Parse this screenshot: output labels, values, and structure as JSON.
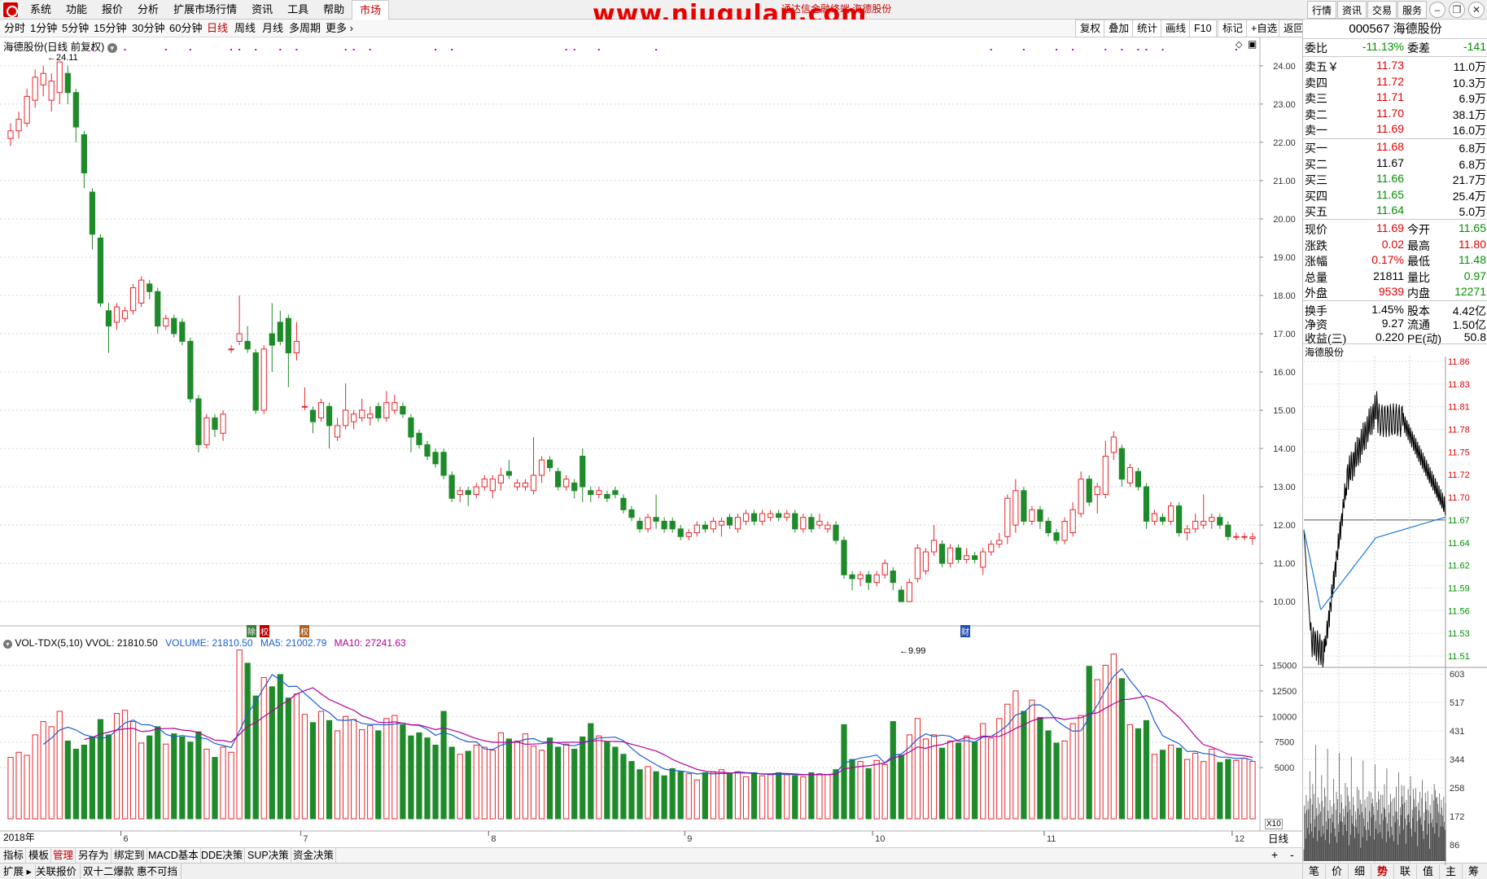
{
  "menu": {
    "items": [
      "系统",
      "功能",
      "报价",
      "分析",
      "扩展市场行情",
      "资讯",
      "工具",
      "帮助",
      "市场"
    ],
    "watermark": "www.niugulan.com",
    "center_title": "通达信金融终端 海德股份",
    "right_buttons": [
      "行情",
      "资讯",
      "交易",
      "服务"
    ]
  },
  "periods": [
    "分时",
    "1分钟",
    "5分钟",
    "15分钟",
    "30分钟",
    "60分钟",
    "日线",
    "周线",
    "月线",
    "多周期",
    "更多"
  ],
  "selected_period": "日线",
  "right_tools": [
    "复权",
    "叠加",
    "统计",
    "画线",
    "F10",
    "标记",
    "+自选",
    "返回"
  ],
  "chart_title": "海德股份(日线 前复权)",
  "price_max_label": "24.11",
  "price_min_label": "9.99",
  "event_labels": [
    "除",
    "权",
    "财"
  ],
  "vol_header": {
    "name": "VOL-TDX(5,10)",
    "vvol": "VVOL: 21810.50",
    "volume": "VOLUME: 21810.50",
    "ma5": "MA5: 21002.79",
    "ma10": "MA10: 27241.63"
  },
  "x_year_label": "2018年",
  "x_period_label": "日线",
  "x10_label": "X10",
  "bottom_tabs": [
    "指标",
    "模板",
    "管理",
    "另存为",
    "绑定到",
    "MACD基本",
    "DDE决策",
    "SUP决策",
    "资金决策"
  ],
  "status_bar": [
    "扩展",
    "关联报价",
    "双十二爆款 惠不可挡"
  ],
  "quote": {
    "header": "000567 海德股份",
    "weibi": {
      "label": "委比",
      "value": "-11.13%",
      "label2": "委差",
      "value2": "-141"
    },
    "asks": [
      {
        "label": "卖五￥",
        "price": "11.73",
        "vol": "11.0万"
      },
      {
        "label": "卖四",
        "price": "11.72",
        "vol": "10.3万"
      },
      {
        "label": "卖三",
        "price": "11.71",
        "vol": "6.9万"
      },
      {
        "label": "卖二",
        "price": "11.70",
        "vol": "38.1万"
      },
      {
        "label": "卖一",
        "price": "11.69",
        "vol": "16.0万"
      }
    ],
    "bids": [
      {
        "label": "买一",
        "price": "11.68",
        "vol": "6.8万"
      },
      {
        "label": "买二",
        "price": "11.67",
        "vol": "6.8万"
      },
      {
        "label": "买三",
        "price": "11.66",
        "vol": "21.7万"
      },
      {
        "label": "买四",
        "price": "11.65",
        "vol": "25.4万"
      },
      {
        "label": "买五",
        "price": "11.64",
        "vol": "5.0万"
      }
    ],
    "stats": [
      {
        "l1": "现价",
        "v1": "11.69",
        "c1": "red",
        "l2": "今开",
        "v2": "11.65",
        "c2": "green"
      },
      {
        "l1": "涨跌",
        "v1": "0.02",
        "c1": "red",
        "l2": "最高",
        "v2": "11.80",
        "c2": "red"
      },
      {
        "l1": "涨幅",
        "v1": "0.17%",
        "c1": "red",
        "l2": "最低",
        "v2": "11.48",
        "c2": "green"
      },
      {
        "l1": "总量",
        "v1": "21811",
        "c1": "black",
        "l2": "量比",
        "v2": "0.97",
        "c2": "green"
      },
      {
        "l1": "外盘",
        "v1": "9539",
        "c1": "red",
        "l2": "内盘",
        "v2": "12271",
        "c2": "green"
      }
    ],
    "stats2": [
      {
        "l1": "换手",
        "v1": "1.45%",
        "l2": "股本",
        "v2": "4.42亿"
      },
      {
        "l1": "净资",
        "v1": "9.27",
        "l2": "流通",
        "v2": "1.50亿"
      },
      {
        "l1": "收益(三)",
        "v1": "0.220",
        "l2": "PE(动)",
        "v2": "50.8"
      }
    ]
  },
  "mini_chart": {
    "title": "海德股份",
    "price_labels": [
      "11.86",
      "11.83",
      "11.81",
      "11.78",
      "11.75",
      "11.72",
      "11.70",
      "11.67",
      "11.64",
      "11.62",
      "11.59",
      "11.56",
      "11.53",
      "11.51"
    ],
    "vol_labels": [
      "603",
      "517",
      "431",
      "344",
      "258",
      "172",
      "86"
    ]
  },
  "mini_tabs": [
    "笔",
    "价",
    "细",
    "势",
    "联",
    "值",
    "主",
    "筹"
  ],
  "mini_tab_selected": "势",
  "chart_data": {
    "type": "candlestick",
    "y_ticks": [
      "24.00",
      "23.00",
      "22.00",
      "21.00",
      "20.00",
      "19.00",
      "18.00",
      "17.00",
      "16.00",
      "15.00",
      "14.00",
      "13.00",
      "12.00",
      "11.00",
      "10.00"
    ],
    "ylim": [
      9.6,
      24.4
    ],
    "x_month_labels": [
      "6",
      "7",
      "8",
      "9",
      "10",
      "11",
      "12"
    ],
    "vol_ticks": [
      "15000",
      "12500",
      "10000",
      "7500",
      "5000"
    ],
    "vol_ylim": [
      0,
      17500
    ],
    "candles": [
      [
        22.1,
        22.3,
        21.9,
        22.5
      ],
      [
        22.3,
        22.6,
        22.1,
        22.8
      ],
      [
        22.5,
        23.2,
        22.4,
        23.4
      ],
      [
        23.1,
        23.7,
        22.9,
        23.9
      ],
      [
        23.5,
        23.8,
        23.2,
        24.0
      ],
      [
        23.1,
        23.6,
        22.8,
        23.8
      ],
      [
        23.3,
        24.1,
        23.0,
        24.11
      ],
      [
        23.8,
        23.3,
        23.0,
        24.0
      ],
      [
        23.3,
        22.4,
        22.0,
        23.4
      ],
      [
        22.2,
        21.2,
        20.8,
        22.3
      ],
      [
        20.7,
        19.6,
        19.2,
        20.8
      ],
      [
        19.5,
        17.8,
        17.7,
        19.6
      ],
      [
        17.6,
        17.2,
        16.5,
        17.8
      ],
      [
        17.3,
        17.7,
        17.1,
        17.8
      ],
      [
        17.4,
        17.6,
        17.3,
        17.7
      ],
      [
        17.6,
        18.2,
        17.5,
        18.3
      ],
      [
        17.8,
        18.4,
        17.7,
        18.5
      ],
      [
        18.3,
        18.1,
        17.9,
        18.4
      ],
      [
        18.1,
        17.2,
        17.0,
        18.2
      ],
      [
        17.2,
        17.4,
        17.1,
        17.5
      ],
      [
        17.4,
        17.0,
        16.9,
        17.5
      ],
      [
        17.3,
        16.8,
        16.7,
        17.4
      ],
      [
        16.8,
        15.3,
        15.2,
        16.9
      ],
      [
        15.3,
        14.1,
        13.9,
        15.4
      ],
      [
        14.1,
        14.8,
        14.0,
        14.9
      ],
      [
        14.8,
        14.5,
        14.3,
        14.9
      ],
      [
        14.4,
        14.9,
        14.2,
        15.0
      ],
      [
        16.6,
        16.6,
        16.5,
        16.7
      ],
      [
        16.8,
        17.0,
        16.7,
        18.0
      ],
      [
        16.8,
        16.6,
        16.5,
        17.2
      ],
      [
        16.5,
        15.0,
        14.9,
        16.6
      ],
      [
        15.0,
        16.6,
        14.9,
        16.7
      ],
      [
        17.0,
        16.7,
        16.0,
        17.8
      ],
      [
        17.3,
        16.8,
        16.7,
        17.6
      ],
      [
        17.4,
        16.5,
        15.6,
        17.5
      ],
      [
        16.5,
        16.8,
        16.3,
        17.3
      ],
      [
        15.1,
        15.1,
        15.0,
        15.6
      ],
      [
        15.0,
        14.7,
        14.4,
        15.1
      ],
      [
        14.8,
        15.2,
        14.7,
        15.3
      ],
      [
        15.1,
        14.6,
        14.0,
        15.2
      ],
      [
        14.3,
        14.6,
        14.2,
        14.8
      ],
      [
        14.6,
        15.0,
        14.5,
        15.7
      ],
      [
        14.7,
        14.9,
        14.5,
        15.0
      ],
      [
        14.8,
        15.0,
        14.7,
        15.3
      ],
      [
        14.8,
        14.9,
        14.6,
        15.1
      ],
      [
        15.1,
        14.8,
        14.7,
        15.2
      ],
      [
        14.8,
        15.2,
        14.7,
        15.5
      ],
      [
        15.0,
        15.2,
        14.9,
        15.4
      ],
      [
        15.1,
        14.9,
        14.8,
        15.2
      ],
      [
        14.8,
        14.3,
        13.9,
        14.9
      ],
      [
        14.4,
        14.1,
        14.0,
        14.5
      ],
      [
        14.1,
        13.8,
        13.7,
        14.2
      ],
      [
        13.9,
        13.6,
        13.5,
        14.0
      ],
      [
        13.9,
        13.3,
        13.2,
        14.0
      ],
      [
        13.3,
        12.7,
        12.6,
        13.4
      ],
      [
        12.8,
        12.9,
        12.6,
        13.0
      ],
      [
        12.9,
        12.8,
        12.5,
        13.0
      ],
      [
        12.8,
        13.0,
        12.7,
        13.1
      ],
      [
        13.0,
        13.2,
        12.9,
        13.3
      ],
      [
        12.9,
        13.2,
        12.7,
        13.3
      ],
      [
        13.1,
        13.3,
        12.9,
        13.5
      ],
      [
        13.4,
        13.3,
        13.2,
        13.7
      ],
      [
        13.0,
        13.1,
        12.9,
        13.2
      ],
      [
        13.0,
        13.1,
        12.9,
        13.2
      ],
      [
        12.9,
        13.3,
        12.8,
        14.3
      ],
      [
        13.3,
        13.7,
        13.1,
        13.8
      ],
      [
        13.7,
        13.5,
        13.4,
        13.8
      ],
      [
        13.4,
        13.0,
        12.9,
        13.5
      ],
      [
        13.0,
        13.2,
        12.9,
        13.3
      ],
      [
        13.1,
        12.9,
        12.7,
        13.2
      ],
      [
        13.8,
        13.0,
        12.6,
        14.0
      ],
      [
        12.9,
        12.8,
        12.6,
        13.0
      ],
      [
        12.8,
        12.9,
        12.7,
        13.0
      ],
      [
        12.8,
        12.7,
        12.6,
        12.9
      ],
      [
        12.9,
        12.8,
        12.7,
        13.0
      ],
      [
        12.7,
        12.4,
        12.3,
        12.8
      ],
      [
        12.4,
        12.2,
        12.1,
        12.5
      ],
      [
        12.1,
        11.9,
        11.8,
        12.2
      ],
      [
        11.9,
        12.2,
        11.8,
        12.3
      ],
      [
        12.2,
        12.1,
        11.9,
        12.8
      ],
      [
        12.1,
        11.9,
        11.8,
        12.2
      ],
      [
        12.1,
        11.9,
        11.8,
        12.2
      ],
      [
        11.9,
        11.7,
        11.6,
        12.0
      ],
      [
        11.7,
        11.8,
        11.6,
        11.9
      ],
      [
        11.8,
        12.0,
        11.7,
        12.1
      ],
      [
        12.0,
        11.9,
        11.8,
        12.1
      ],
      [
        11.9,
        12.1,
        11.8,
        12.2
      ],
      [
        12.0,
        12.1,
        11.7,
        12.2
      ],
      [
        12.2,
        12.0,
        11.9,
        12.3
      ],
      [
        11.9,
        12.2,
        11.8,
        12.3
      ],
      [
        12.1,
        12.3,
        12.0,
        12.4
      ],
      [
        12.3,
        12.1,
        12.0,
        12.4
      ],
      [
        12.1,
        12.3,
        12.0,
        12.4
      ],
      [
        12.2,
        12.3,
        12.1,
        12.4
      ],
      [
        12.3,
        12.2,
        12.1,
        12.4
      ],
      [
        12.2,
        12.3,
        12.1,
        12.4
      ],
      [
        12.3,
        11.9,
        11.8,
        12.4
      ],
      [
        11.9,
        12.2,
        11.8,
        12.3
      ],
      [
        12.2,
        11.9,
        11.8,
        12.3
      ],
      [
        12.0,
        12.1,
        11.9,
        12.3
      ],
      [
        11.9,
        12.0,
        11.8,
        12.1
      ],
      [
        12.0,
        11.6,
        11.5,
        12.1
      ],
      [
        11.6,
        10.7,
        10.6,
        11.7
      ],
      [
        10.7,
        10.6,
        10.3,
        10.8
      ],
      [
        10.6,
        10.7,
        10.4,
        10.8
      ],
      [
        10.7,
        10.5,
        10.3,
        10.8
      ],
      [
        10.5,
        10.7,
        10.4,
        10.8
      ],
      [
        10.7,
        11.0,
        10.6,
        11.1
      ],
      [
        10.8,
        10.5,
        10.3,
        10.9
      ],
      [
        10.3,
        10.0,
        9.99,
        10.4
      ],
      [
        10.0,
        10.5,
        9.99,
        10.6
      ],
      [
        10.6,
        11.4,
        10.5,
        11.5
      ],
      [
        10.8,
        11.3,
        10.7,
        11.4
      ],
      [
        11.3,
        11.6,
        11.2,
        12.0
      ],
      [
        11.5,
        11.0,
        10.9,
        11.6
      ],
      [
        11.0,
        11.4,
        10.9,
        11.5
      ],
      [
        11.4,
        11.1,
        11.0,
        11.5
      ],
      [
        11.1,
        11.2,
        11.0,
        11.4
      ],
      [
        11.2,
        11.1,
        11.0,
        11.3
      ],
      [
        10.9,
        11.3,
        10.7,
        11.4
      ],
      [
        11.3,
        11.5,
        11.2,
        11.6
      ],
      [
        11.5,
        11.6,
        11.4,
        11.8
      ],
      [
        11.7,
        12.7,
        11.5,
        12.8
      ],
      [
        12.0,
        12.9,
        11.8,
        13.2
      ],
      [
        12.9,
        12.1,
        12.0,
        13.0
      ],
      [
        12.1,
        12.4,
        12.0,
        12.5
      ],
      [
        12.4,
        12.1,
        11.9,
        12.5
      ],
      [
        12.1,
        11.8,
        11.7,
        12.2
      ],
      [
        11.8,
        11.6,
        11.5,
        11.9
      ],
      [
        11.6,
        12.1,
        11.5,
        12.2
      ],
      [
        11.8,
        12.4,
        11.7,
        12.6
      ],
      [
        12.3,
        13.2,
        12.2,
        13.4
      ],
      [
        13.2,
        12.6,
        12.5,
        13.3
      ],
      [
        12.8,
        13.0,
        12.3,
        13.1
      ],
      [
        12.8,
        13.8,
        12.7,
        14.2
      ],
      [
        13.9,
        14.3,
        13.7,
        14.45
      ],
      [
        14.0,
        13.2,
        13.0,
        14.1
      ],
      [
        13.1,
        13.5,
        13.0,
        13.6
      ],
      [
        13.4,
        13.0,
        12.9,
        13.5
      ],
      [
        13.0,
        12.1,
        11.9,
        13.1
      ],
      [
        12.1,
        12.3,
        12.0,
        12.4
      ],
      [
        12.2,
        12.1,
        12.0,
        12.3
      ],
      [
        12.1,
        12.5,
        12.0,
        12.6
      ],
      [
        12.5,
        11.8,
        11.7,
        12.6
      ],
      [
        11.8,
        11.9,
        11.6,
        12.0
      ],
      [
        11.9,
        12.1,
        11.8,
        12.3
      ],
      [
        12.0,
        12.1,
        11.9,
        12.8
      ],
      [
        12.1,
        12.2,
        11.9,
        12.3
      ],
      [
        12.2,
        12.0,
        11.9,
        12.3
      ],
      [
        12.0,
        11.7,
        11.6,
        12.1
      ],
      [
        11.7,
        11.7,
        11.6,
        11.8
      ],
      [
        11.7,
        11.7,
        11.6,
        11.8
      ],
      [
        11.65,
        11.69,
        11.48,
        11.8
      ]
    ],
    "volumes": [
      6000,
      6500,
      6200,
      8200,
      9500,
      9000,
      10500,
      7600,
      6800,
      7200,
      8000,
      9700,
      8200,
      10300,
      10600,
      9500,
      7400,
      8100,
      9000,
      7300,
      8300,
      8000,
      7500,
      8500,
      6800,
      6000,
      7000,
      6500,
      16500,
      15200,
      12000,
      13800,
      12900,
      14100,
      11800,
      12200,
      10200,
      9400,
      10500,
      9600,
      8600,
      10000,
      9700,
      8700,
      9100,
      8600,
      9800,
      10100,
      9200,
      8100,
      8400,
      7900,
      7200,
      10500,
      7000,
      6300,
      6600,
      7200,
      7000,
      6700,
      8400,
      7800,
      7600,
      8300,
      7100,
      6700,
      7900,
      7000,
      7300,
      6800,
      8000,
      9300,
      8100,
      7500,
      7000,
      6300,
      5600,
      4800,
      5100,
      4600,
      4200,
      4900,
      4600,
      4400,
      3800,
      4500,
      4600,
      4800,
      4400,
      4600,
      4100,
      4500,
      4200,
      4300,
      4500,
      4300,
      4200,
      4100,
      4500,
      4400,
      4300,
      4800,
      9200,
      5800,
      5600,
      4900,
      5700,
      5300,
      9500,
      6200,
      8200,
      9800,
      7800,
      8200,
      6900,
      7600,
      7400,
      8100,
      7500,
      9300,
      7900,
      9800,
      11200,
      12500,
      10500,
      11600,
      9900,
      8600,
      7400,
      7600,
      9300,
      10100,
      14900,
      13600,
      15000,
      16100,
      13700,
      9200,
      8800,
      9600,
      6300,
      6700,
      7200,
      6900,
      5800,
      6400,
      5600,
      6800,
      5500,
      5800,
      5700,
      5900,
      5600,
      5100,
      4800,
      5400,
      4700
    ]
  }
}
